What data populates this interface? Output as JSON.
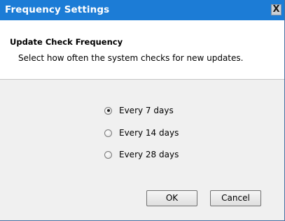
{
  "window": {
    "title": "Frequency Settings",
    "close_label": "X"
  },
  "header": {
    "heading": "Update Check Frequency",
    "description": "Select how often the system checks for new updates."
  },
  "options": [
    {
      "label": "Every 7 days",
      "checked": true
    },
    {
      "label": "Every 14 days",
      "checked": false
    },
    {
      "label": "Every 28 days",
      "checked": false
    }
  ],
  "buttons": {
    "ok_label": "OK",
    "cancel_label": "Cancel"
  },
  "colors": {
    "titlebar": "#1c7cd6",
    "body_background": "#f0f0f0"
  }
}
